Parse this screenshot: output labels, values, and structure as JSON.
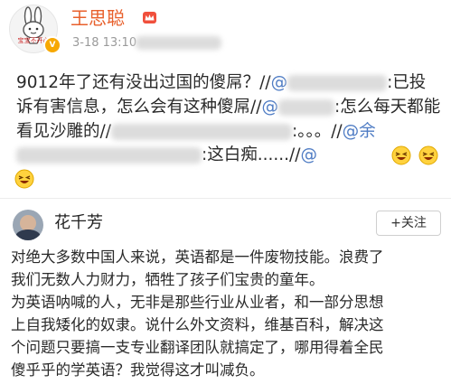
{
  "post": {
    "avatar_caption": "宝宝不开心",
    "username": "王思聪",
    "vip_icon": "crown-icon",
    "verified_icon": "verified-badge-icon",
    "timestamp": "3-18 13:10",
    "lines": {
      "l1a": "9012年了还有没出过国的傻屌？//",
      "l1b": "@",
      "l1c": ":已投",
      "l2a": "诉有害信息，怎么会有这种傻屌//",
      "l2b": "@",
      "l2c": ":怎么每天都能",
      "l3a": "看见沙雕的//",
      "l3b": ":。。。//",
      "l3c": "@余",
      "l4a": ":这白痴......//",
      "l4b": "@"
    },
    "emoji": "laughing-emoji"
  },
  "comment": {
    "username": "花千芳",
    "follow_label": "+关注",
    "lines": [
      "对绝大多数中国人来说，英语都是一件废物技能。浪费了",
      "我们无数人力财力，牺牲了孩子们宝贵的童年。",
      "为英语呐喊的人，无非是那些行业从业者，和一部分思想",
      "上自我矮化的奴隶。说什么外文资料，维基百科，解决这",
      "个问题只要搞一支专业翻译团队就搞定了，哪用得着全民",
      "傻乎乎的学英语？我觉得这才叫减负。",
      ""
    ]
  },
  "colors": {
    "username": "#e8602c",
    "mention": "#4f7cc4",
    "timestamp": "#9a9a9a"
  }
}
